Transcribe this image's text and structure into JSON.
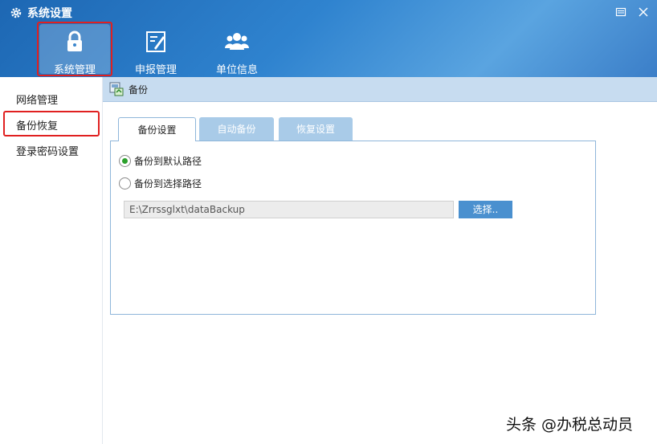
{
  "window": {
    "title": "系统设置"
  },
  "toolbar": {
    "items": [
      {
        "label": "系统管理",
        "icon": "lock-icon"
      },
      {
        "label": "申报管理",
        "icon": "edit-document-icon"
      },
      {
        "label": "单位信息",
        "icon": "users-icon"
      }
    ]
  },
  "sidebar": {
    "items": [
      {
        "label": "网络管理"
      },
      {
        "label": "备份恢复"
      },
      {
        "label": "登录密码设置"
      }
    ]
  },
  "content": {
    "section_title": "备份",
    "tabs": [
      {
        "label": "备份设置"
      },
      {
        "label": "自动备份"
      },
      {
        "label": "恢复设置"
      }
    ],
    "options": [
      {
        "label": "备份到默认路径",
        "selected": true
      },
      {
        "label": "备份到选择路径",
        "selected": false
      }
    ],
    "path_value": "E:\\Zrrssglxt\\dataBackup",
    "choose_label": "选择.."
  },
  "watermark": "头条 @办税总动员",
  "colors": {
    "accent": "#2f83cf",
    "highlight": "#e02020",
    "radio_selected": "#2ca02c"
  }
}
